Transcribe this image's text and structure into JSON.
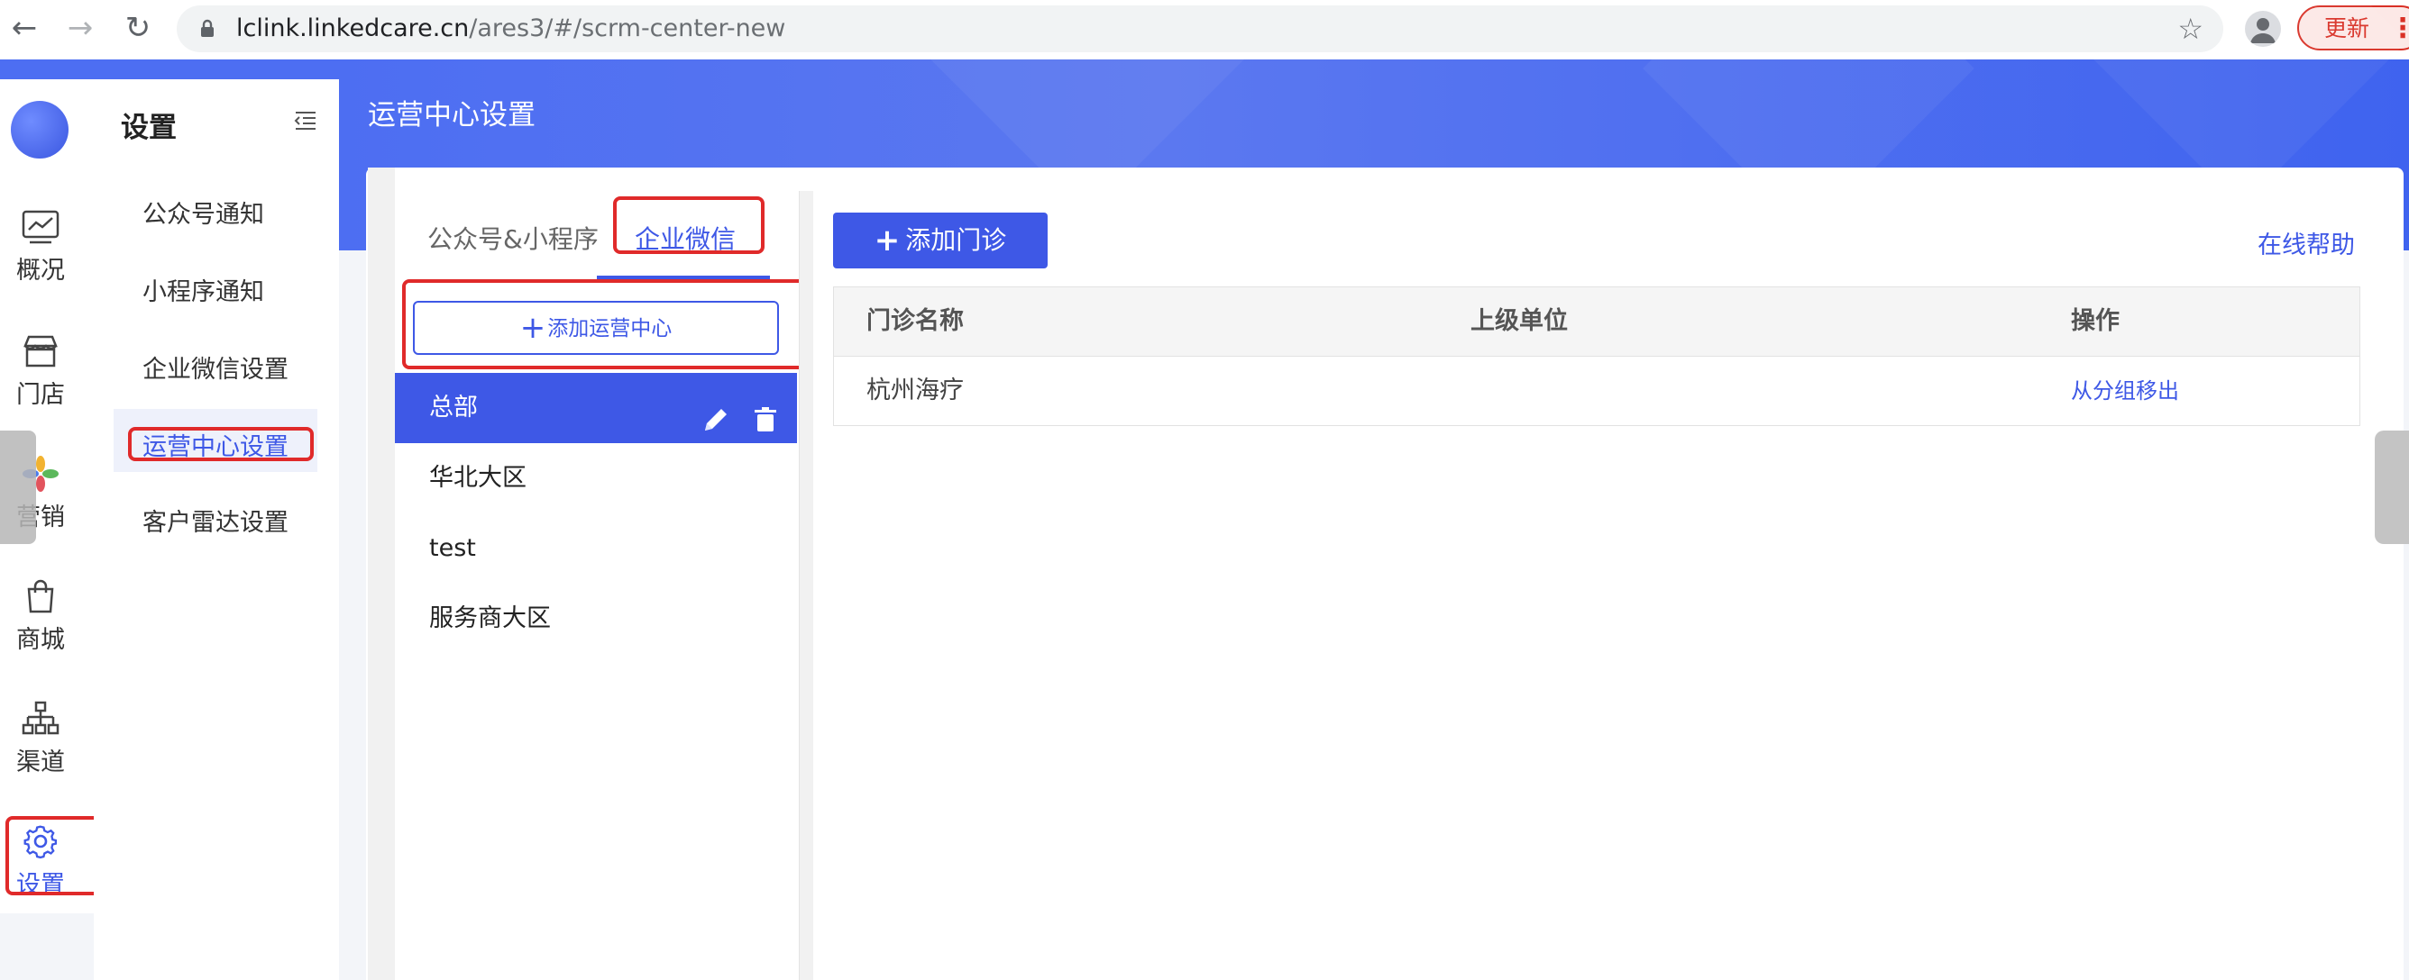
{
  "browser": {
    "url_host": "lclink.linkedcare.cn",
    "url_path": "/ares3/#/scrm-center-new",
    "update_label": "更新",
    "menu_glyph": "⋮"
  },
  "header": {
    "title": "运营中心设置"
  },
  "rail": {
    "items": [
      {
        "label": "概况",
        "icon": "chart-icon"
      },
      {
        "label": "门店",
        "icon": "store-icon"
      },
      {
        "label": "营销",
        "icon": "marketing-icon"
      },
      {
        "label": "商城",
        "icon": "shopping-bag-icon"
      },
      {
        "label": "渠道",
        "icon": "channel-icon"
      },
      {
        "label": "设置",
        "icon": "gear-icon"
      }
    ],
    "active": "设置"
  },
  "submenu": {
    "title": "设置",
    "items": [
      {
        "label": "公众号通知"
      },
      {
        "label": "小程序通知"
      },
      {
        "label": "企业微信设置"
      },
      {
        "label": "运营中心设置"
      },
      {
        "label": "客户雷达设置"
      }
    ],
    "active": "运营中心设置"
  },
  "tabs": [
    {
      "label": "公众号&小程序"
    },
    {
      "label": "企业微信"
    }
  ],
  "active_tab": "企业微信",
  "left_panel": {
    "add_button": "添加运营中心",
    "groups": [
      {
        "label": "总部"
      },
      {
        "label": "华北大区"
      },
      {
        "label": "test"
      },
      {
        "label": "服务商大区"
      }
    ],
    "active_group": "总部"
  },
  "right_panel": {
    "add_button": "添加门诊",
    "help_link": "在线帮助",
    "table": {
      "columns": [
        "门诊名称",
        "上级单位",
        "操作"
      ],
      "rows": [
        {
          "name": "杭州海疗",
          "parent": "",
          "action": "从分组移出"
        }
      ]
    }
  },
  "colors": {
    "primary": "#3e58e6",
    "header_band": "#4d6ef2",
    "annotation": "#e02a2a"
  }
}
